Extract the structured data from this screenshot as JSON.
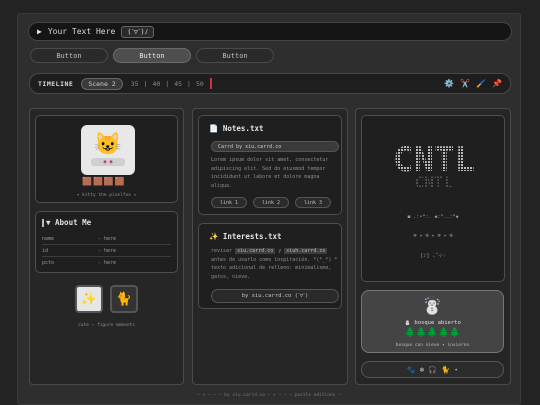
{
  "topbar": {
    "text": "Your Text Here",
    "face": "(ˊ▽ˋ)ﾉ"
  },
  "buttons": [
    "Button",
    "Button",
    "Button"
  ],
  "timeline": {
    "title": "TIMELINE",
    "scene": "Scene 2",
    "frames": [
      "35",
      "|",
      "40",
      "|",
      "45",
      "|",
      "50"
    ],
    "tools": [
      "⚙️",
      "✂️",
      "🖌️",
      "📌"
    ]
  },
  "left": {
    "cat_bar": "◉ ◉",
    "cups": "🟫🟫🟫🟫",
    "cat_caption": "✦ kitty the pixelfox ✦",
    "about_title": "▼ About Me",
    "rows": [
      {
        "k": "name",
        "v": "- here"
      },
      {
        "k": "id",
        "v": "- here"
      },
      {
        "k": "pcto",
        "v": "- here"
      }
    ],
    "icon1": "✨",
    "icon2": "🐈",
    "icons_caption": "cute ✧ figure moments"
  },
  "middle": {
    "notes_title": "Notes.txt",
    "notes_input": "Carrd by xiu.carrd.co",
    "notes_text": "Lorem ipsum dolor sit amet, consectetur adipiscing elit. Sed do eiusmod tempor incididunt ut labore et dolore magna aliqua.",
    "links": [
      "link 1",
      "link 2",
      "link 3"
    ],
    "interests_title": "Interests.txt",
    "interests_pre": "revisar ",
    "interests_hl1": "xiu.carrd.co",
    "interests_mid": " y ",
    "interests_hl2": "xiuh.carrd.co",
    "interests_post": " antes de usarlo como inspiración. *(*_*) * texto adicional de relleno: minimalismo, gatos, nieve.",
    "credit": "by xiu.carrd.co (ˊ▽ˋ)"
  },
  "right": {
    "art_text": "CNTL",
    "line1": "◼ .:•*:. ◆:*..:*◆",
    "line2": "❄ ✦ ❄ ✦ ❄ ✦ ❄",
    "line3": "[♪] ₊˚⊹♡",
    "snowman": "☃️",
    "snow_title": "⛄ bosque abierto",
    "trees": "🌲🌲🌲🌲🌲",
    "snow_caption": "bosque con nieve ✦ invierno",
    "bottom_icons": "🐾 ❄ 🎧 🐈 ⋆"
  },
  "footer": "— ✦ — ⋆ — by xiu.carrd.co — ✦ — ⋆ — pastle editions —"
}
